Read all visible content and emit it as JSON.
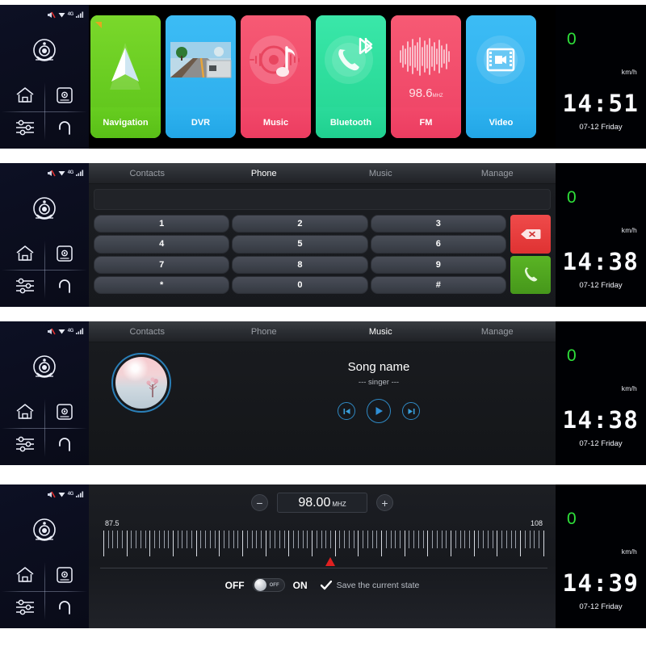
{
  "sidebar": {
    "status_icons": [
      {
        "name": "mute-icon",
        "label": "mute"
      },
      {
        "name": "wifi-icon",
        "label": "wifi"
      },
      {
        "name": "network-4g-label",
        "label": "4G"
      },
      {
        "name": "signal-bars-icon",
        "label": "signal"
      }
    ],
    "camera_label": "camera",
    "buttons": [
      {
        "name": "home-icon",
        "label": "Home"
      },
      {
        "name": "apps-icon",
        "label": "Apps"
      },
      {
        "name": "equalizer-icon",
        "label": "Settings"
      },
      {
        "name": "back-arrow-icon",
        "label": "Back"
      }
    ]
  },
  "info": {
    "speed": "0",
    "speed_unit": "km/h",
    "date": "07-12  Friday",
    "accent_speed_color": "#2ee03a"
  },
  "panels": {
    "home": {
      "clock": "14:51",
      "tiles": [
        {
          "label": "Navigation",
          "icon": "navigation-arrow-icon",
          "color": "#6cd124"
        },
        {
          "label": "DVR",
          "icon": "dashcam-road-icon",
          "color": "#34b7f1"
        },
        {
          "label": "Music",
          "icon": "vinyl-note-icon",
          "color": "#f4536e"
        },
        {
          "label": "Bluetooth",
          "icon": "bluetooth-phone-icon",
          "color": "#2fe0a0"
        },
        {
          "label": "FM",
          "icon": "fm-waveform-icon",
          "color": "#f4536e",
          "display": "98.6",
          "display_unit": "MHZ"
        },
        {
          "label": "Video",
          "icon": "film-camera-icon",
          "color": "#34b7f1"
        }
      ]
    },
    "phone": {
      "clock": "14:38",
      "tabs": [
        {
          "label": "Contacts",
          "active": false
        },
        {
          "label": "Phone",
          "active": true
        },
        {
          "label": "Music",
          "active": false
        },
        {
          "label": "Manage",
          "active": false
        }
      ],
      "input_value": "",
      "keys": [
        "1",
        "2",
        "3",
        "4",
        "5",
        "6",
        "7",
        "8",
        "9",
        "*",
        "0",
        "#"
      ],
      "delete_label": "backspace-icon",
      "call_label": "call-icon",
      "delete_color": "#e03b3b",
      "call_color": "#4a9e24"
    },
    "music": {
      "clock": "14:38",
      "tabs": [
        {
          "label": "Contacts",
          "active": false
        },
        {
          "label": "Phone",
          "active": false
        },
        {
          "label": "Music",
          "active": true
        },
        {
          "label": "Manage",
          "active": false
        }
      ],
      "song_title": "Song name",
      "song_artist": "--- singer ---",
      "controls": [
        {
          "name": "previous-track-button",
          "glyph": "⏮"
        },
        {
          "name": "play-button",
          "glyph": "▶"
        },
        {
          "name": "next-track-button",
          "glyph": "⏭"
        }
      ],
      "accent_color": "#2f89c4"
    },
    "fm": {
      "clock": "14:39",
      "frequency": "98.00",
      "frequency_unit": "MHZ",
      "minus_label": "−",
      "plus_label": "+",
      "scale_min": "87.5",
      "scale_max": "108",
      "marker_percent": 51.5,
      "off_label": "OFF",
      "on_label": "ON",
      "toggle_state": "OFF",
      "toggle_knob_text": "OFF",
      "save_label": "Save the current state",
      "save_checked": true,
      "marker_color": "#e02020"
    }
  }
}
